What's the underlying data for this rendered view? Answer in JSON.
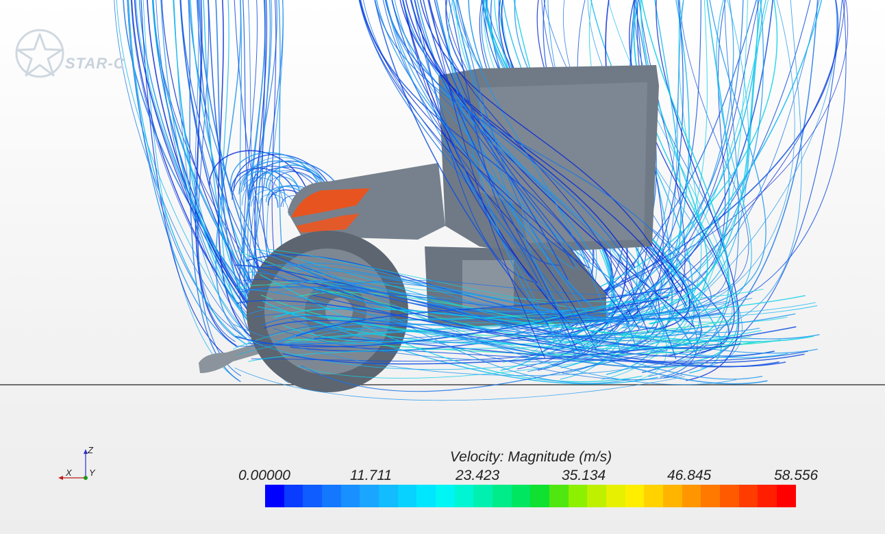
{
  "logo": {
    "text": "STAR-C"
  },
  "legend": {
    "title": "Velocity: Magnitude (m/s)",
    "ticks": [
      "0.00000",
      "11.711",
      "23.423",
      "35.134",
      "46.845",
      "58.556"
    ],
    "colors": [
      "#0000ff",
      "#0a3cff",
      "#0f5cff",
      "#1478ff",
      "#1890ff",
      "#1aa6ff",
      "#12bcff",
      "#08d2ff",
      "#00e6ff",
      "#00f5f5",
      "#00f5d2",
      "#00f0b0",
      "#00eb8a",
      "#00e660",
      "#10e030",
      "#50e610",
      "#8cf000",
      "#bef000",
      "#e6f000",
      "#ffee00",
      "#ffd200",
      "#ffb400",
      "#ff9600",
      "#ff7800",
      "#ff5a00",
      "#ff3c00",
      "#ff1e00",
      "#ff0000"
    ]
  },
  "axes": {
    "z": "Z",
    "x": "X",
    "y": "Y"
  },
  "scene": {
    "body_color": "#6f7a86",
    "highlight_color": "#e8541f",
    "streamline_colors": [
      "#0a2ad6",
      "#1250e0",
      "#1a74e8",
      "#1f96ef",
      "#12b8f2",
      "#0fd0e8",
      "#20e0c0"
    ]
  }
}
